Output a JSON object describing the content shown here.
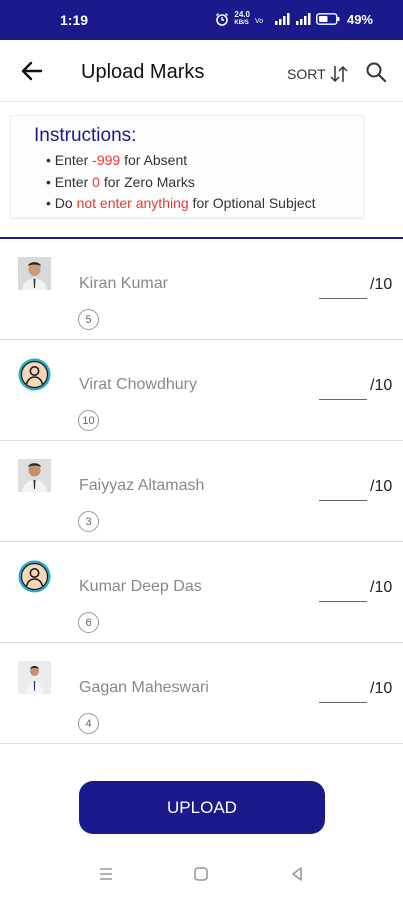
{
  "status_bar": {
    "time": "1:19",
    "battery": "49%",
    "speed": "24.0",
    "speed_unit": "KB/S"
  },
  "app_bar": {
    "title": "Upload Marks",
    "sort_label": "SORT",
    "back_icon": "arrow-left-icon",
    "sort_icon": "sort-arrows-icon",
    "search_icon": "search-icon"
  },
  "instructions": {
    "title": "Instructions:",
    "line1_prefix": "• Enter ",
    "line1_value": "-999",
    "line1_suffix": " for Absent",
    "line2_prefix": "• Enter ",
    "line2_value": "0",
    "line2_suffix": " for Zero Marks",
    "line3_prefix": "• Do ",
    "line3_value": "not enter anything",
    "line3_suffix": " for Optional Subject"
  },
  "students": [
    {
      "name": "Kiran Kumar",
      "roll": "5",
      "max_marks": "/10",
      "marks": "",
      "avatar": "photo"
    },
    {
      "name": "Virat Chowdhury",
      "roll": "10",
      "max_marks": "/10",
      "marks": "",
      "avatar": "default"
    },
    {
      "name": "Faiyyaz Altamash",
      "roll": "3",
      "max_marks": "/10",
      "marks": "",
      "avatar": "photo"
    },
    {
      "name": "Kumar Deep Das",
      "roll": "6",
      "max_marks": "/10",
      "marks": "",
      "avatar": "default"
    },
    {
      "name": "Gagan Maheswari",
      "roll": "4",
      "max_marks": "/10",
      "marks": "",
      "avatar": "photo"
    }
  ],
  "upload_label": "UPLOAD",
  "colors": {
    "primary": "#1a1a8c",
    "accent_red": "#e53935",
    "avatar_teal": "#2aa8c6"
  }
}
